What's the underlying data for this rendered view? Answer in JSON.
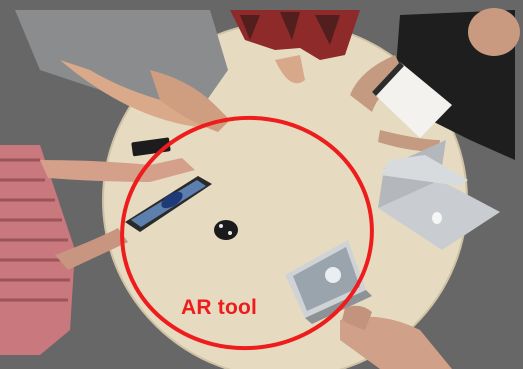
{
  "annotation": {
    "label": "AR tool",
    "color": "#ee1c1c"
  },
  "scene": {
    "floor_color": "#6e6e6e",
    "table_color": "#e6dbc0"
  }
}
